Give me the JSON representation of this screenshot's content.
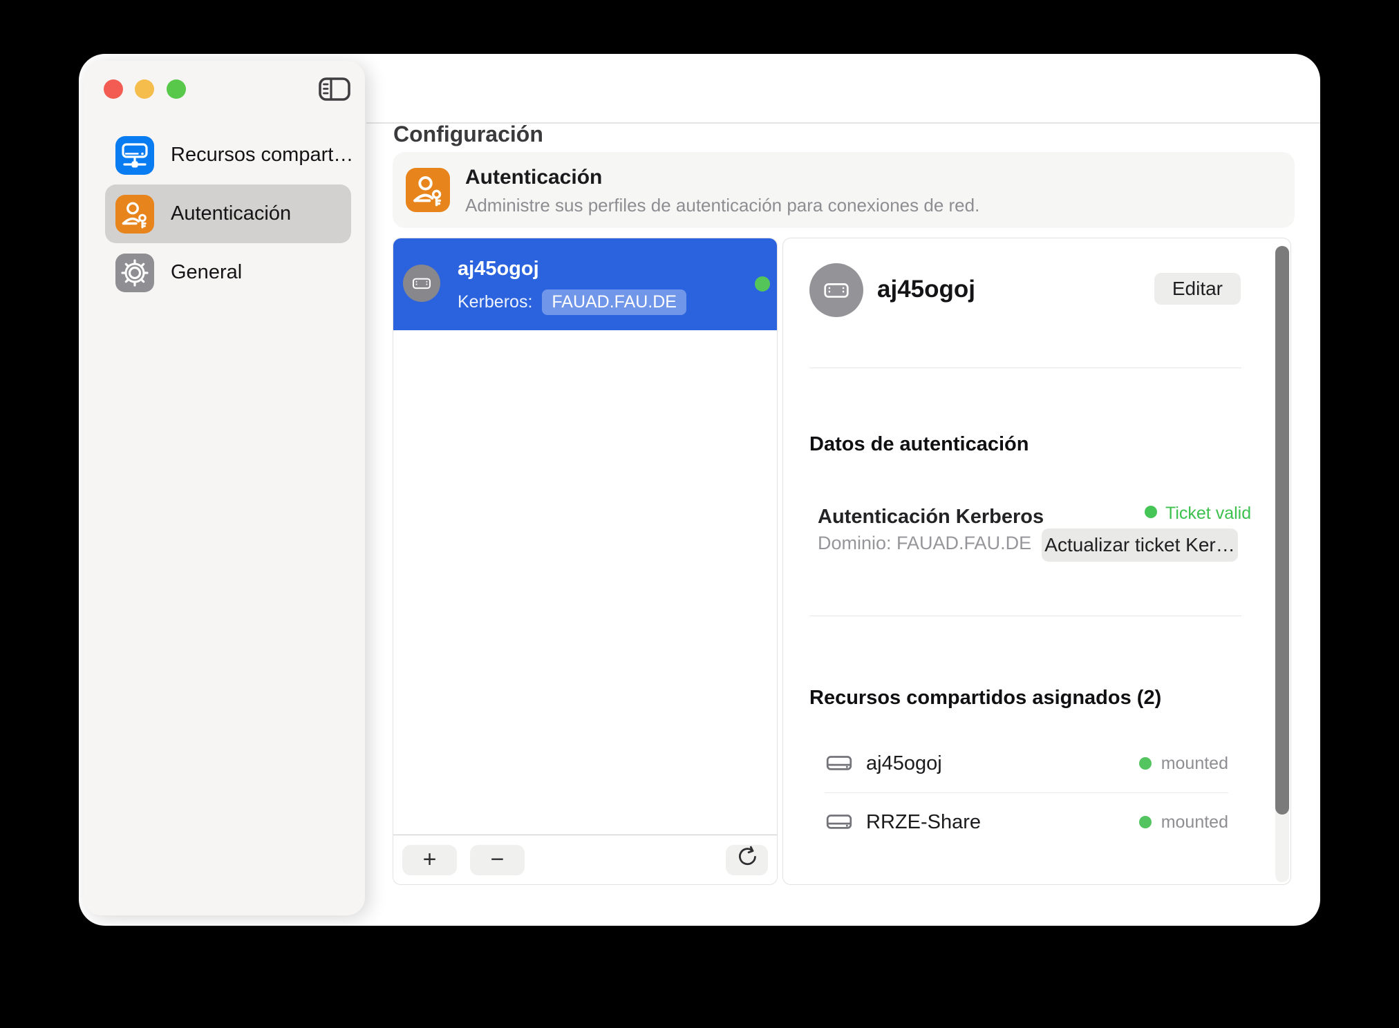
{
  "window": {
    "title": "Configuración"
  },
  "sidebar": {
    "items": [
      {
        "label": "Recursos compart…",
        "icon": "network-drive",
        "selected": false
      },
      {
        "label": "Autenticación",
        "icon": "person-key",
        "selected": true
      },
      {
        "label": "General",
        "icon": "gear",
        "selected": false
      }
    ]
  },
  "banner": {
    "title": "Autenticación",
    "subtitle": "Administre sus perfiles de autenticación para conexiones de red."
  },
  "profiles": {
    "selected": {
      "name": "aj45ogoj",
      "protocol_label": "Kerberos:",
      "realm_badge": "FAUAD.FAU.DE"
    },
    "toolbar": {
      "add_label": "+",
      "remove_label": "−"
    }
  },
  "detail": {
    "name": "aj45ogoj",
    "edit_label": "Editar",
    "auth_section_title": "Datos de autenticación",
    "kerberos_label": "Autenticación Kerberos",
    "domain_label": "Dominio: FAUAD.FAU.DE",
    "ticket_status": "Ticket valid",
    "renew_button_label": "Actualizar ticket Ker…",
    "shares_section_title": "Recursos compartidos asignados (2)",
    "shares": [
      {
        "name": "aj45ogoj",
        "status": "mounted"
      },
      {
        "name": "RRZE-Share",
        "status": "mounted"
      }
    ]
  },
  "colors": {
    "selection_blue": "#2b63de",
    "icon_blue": "#0a7cf2",
    "icon_orange": "#e8841c",
    "icon_gray": "#8e8e93",
    "status_green": "#46c557",
    "sidebar_selected": "#d2d1cf",
    "traffic_red": "#f25c52",
    "traffic_yellow": "#f5bd4c",
    "traffic_green": "#58c84b"
  }
}
